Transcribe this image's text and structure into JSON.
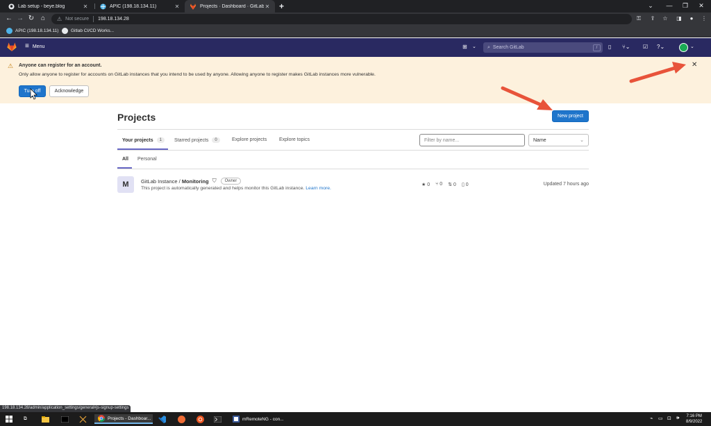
{
  "browser": {
    "tabs": [
      {
        "label": "Lab setup - beye.blog",
        "icon": "github-icon"
      },
      {
        "label": "APIC (198.18.134.11)",
        "icon": "globe-icon"
      },
      {
        "label": "Projects · Dashboard · GitLab",
        "icon": "gitlab-icon",
        "active": true
      }
    ],
    "security_label": "Not secure",
    "url": "198.18.134.28",
    "bookmarks": [
      {
        "label": "APIC (198.18.134.11)",
        "icon": "globe-icon"
      },
      {
        "label": "Gitlab CI/CD Works...",
        "icon": "github-icon"
      }
    ],
    "status_url": "198.18.134.28/admin/application_settings/general#js-signup-settings"
  },
  "gitlab_header": {
    "menu_label": "Menu",
    "search_placeholder": "Search GitLab",
    "search_shortcut": "/"
  },
  "alert": {
    "title": "Anyone can register for an account.",
    "body": "Only allow anyone to register for accounts on GitLab instances that you intend to be used by anyone. Allowing anyone to register makes GitLab instances more vulnerable.",
    "turn_off_label": "Turn off",
    "acknowledge_label": "Acknowledge"
  },
  "projects": {
    "title": "Projects",
    "new_project_label": "New project",
    "tabs": [
      {
        "label": "Your projects",
        "count": "1",
        "active": true
      },
      {
        "label": "Starred projects",
        "count": "0"
      },
      {
        "label": "Explore projects"
      },
      {
        "label": "Explore topics"
      }
    ],
    "filter_placeholder": "Filter by name...",
    "sort_value": "Name",
    "subtabs": [
      {
        "label": "All",
        "active": true
      },
      {
        "label": "Personal"
      }
    ],
    "items": [
      {
        "avatar_letter": "M",
        "namespace": "GitLab Instance",
        "name": "Monitoring",
        "role": "Owner",
        "description": "This project is automatically generated and helps monitor this GitLab instance.",
        "learn_more": "Learn more.",
        "stars": "0",
        "forks": "0",
        "merge_requests": "0",
        "issues": "0",
        "updated": "Updated 7 hours ago"
      }
    ]
  },
  "taskbar": {
    "items": [
      {
        "label": "Projects - Dashboar..."
      },
      {
        "label": "mRemoteNG - con..."
      }
    ],
    "time": "7:16 PM",
    "date": "8/9/2022"
  },
  "colors": {
    "gitlab_header": "#292961",
    "alert_bg": "#fdf1dd",
    "primary": "#1f75cb",
    "annotation_arrow": "#e8533a"
  }
}
